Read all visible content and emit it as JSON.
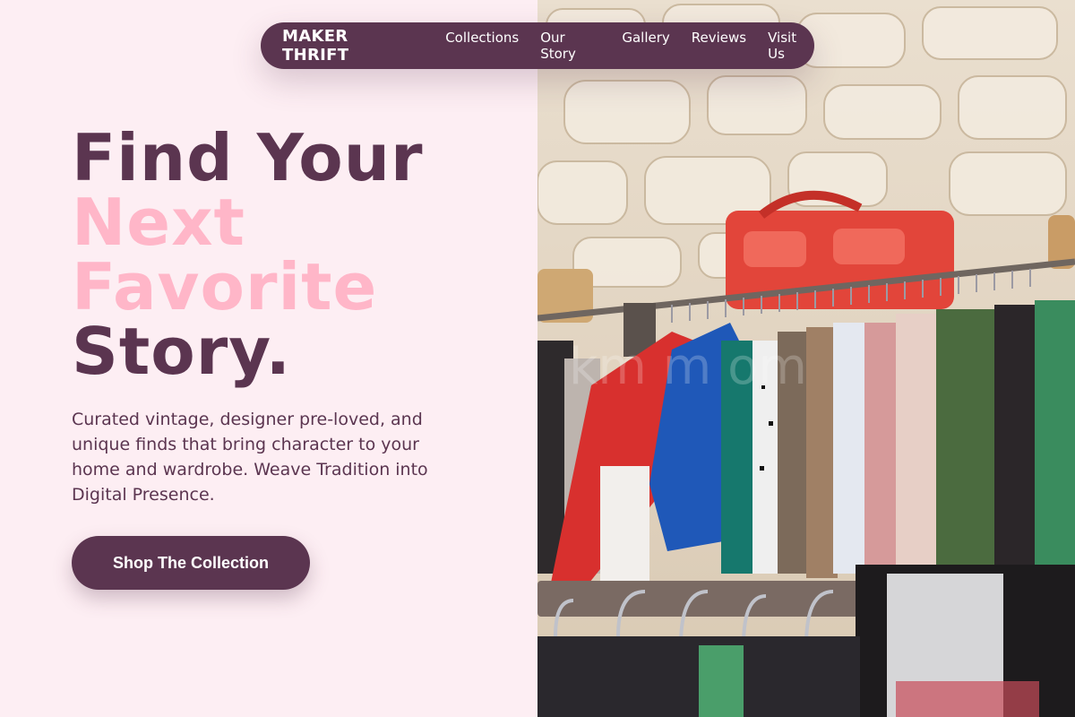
{
  "nav": {
    "brand": "MAKER THRIFT",
    "links": [
      "Collections",
      "Our Story",
      "Gallery",
      "Reviews",
      "Visit Us"
    ]
  },
  "hero": {
    "headline_line1": "Find Your",
    "headline_line2": "Next",
    "headline_line3": "Favorite",
    "headline_line4": "Story.",
    "subtext": "Curated vintage, designer pre-loved, and unique finds that bring character to your home and wardrobe. Weave Tradition into Digital Presence.",
    "cta_label": "Shop The Collection"
  },
  "image": {
    "description_icon": "clothing-rack-photo",
    "watermark": "km  m  om"
  },
  "colors": {
    "primary": "#5b3550",
    "accent_pink": "#ffb6c8",
    "background": "#fdeef3"
  }
}
